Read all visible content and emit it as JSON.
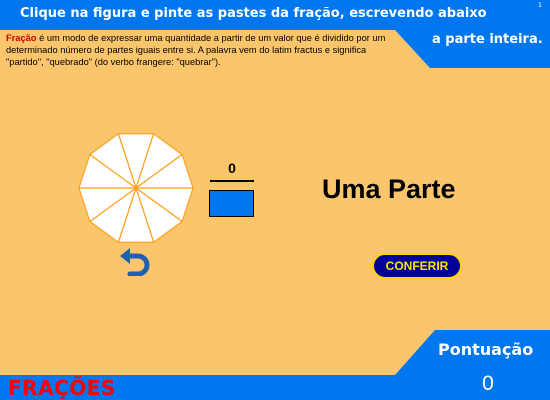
{
  "header": {
    "instruction_line1": "Clique na figura e pinte as pastes da fração, escrevendo abaixo",
    "instruction_line2": "a parte inteira.",
    "corner_mark": "1"
  },
  "definition": {
    "term": "Fração",
    "text": " é um modo de expressar uma quantidade a partir de um valor que é dividido por um determinado número de partes iguais entre si. A palavra vem do latim fractus e significa \"partido\", \"quebrado\" (do verbo frangere: \"quebrar\")."
  },
  "figure": {
    "shape": "decagon",
    "total_parts": 10,
    "painted_parts": 0,
    "fill_color": "#ffffff",
    "painted_color": "#0077ee",
    "line_color": "#ffa020"
  },
  "fraction": {
    "numerator": "0",
    "denominator": ""
  },
  "answer_text": "Uma Parte",
  "check_button": {
    "label": "CONFERIR"
  },
  "score": {
    "label": "Pontuação",
    "value": "0"
  },
  "footer": {
    "title": "FRAÇÕES"
  },
  "icons": {
    "undo": "undo-arrow-icon"
  },
  "colors": {
    "background": "#fbc56c",
    "band": "#0077ee",
    "highlight": "#ffe400",
    "title_red": "#ff0000"
  }
}
